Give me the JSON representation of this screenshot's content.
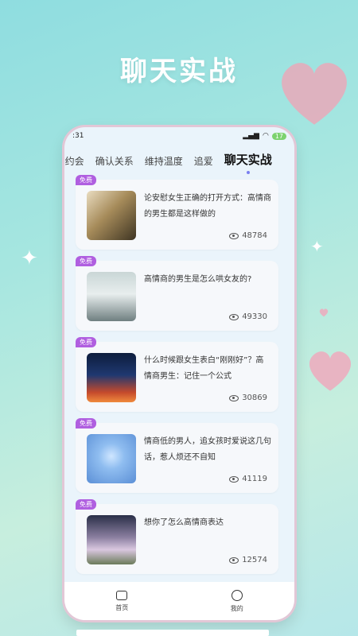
{
  "hero": {
    "title": "聊天实战"
  },
  "status": {
    "time": ":31",
    "battery": "17"
  },
  "tabs": [
    {
      "label": "]约会"
    },
    {
      "label": "确认关系"
    },
    {
      "label": "维持温度"
    },
    {
      "label": "追爱"
    },
    {
      "label": "聊天实战"
    }
  ],
  "articles": [
    {
      "badge": "免费",
      "title": "论安慰女生正确的打开方式：高情商的男生都是这样做的",
      "views": "48784"
    },
    {
      "badge": "免费",
      "title": "高情商的男生是怎么哄女友的?",
      "views": "49330"
    },
    {
      "badge": "免费",
      "title": "什么时候跟女生表白“刚刚好”？高情商男生：记住一个公式",
      "views": "30869"
    },
    {
      "badge": "免费",
      "title": "情商低的男人，追女孩时爱说这几句话，惹人烦还不自知",
      "views": "41119"
    },
    {
      "badge": "免费",
      "title": "想你了怎么高情商表达",
      "views": "12574"
    }
  ],
  "nav": {
    "home": "首页",
    "mine": "我的"
  },
  "colors": {
    "accent": "#b05fe0",
    "tab_dot": "#7a7ff0"
  }
}
